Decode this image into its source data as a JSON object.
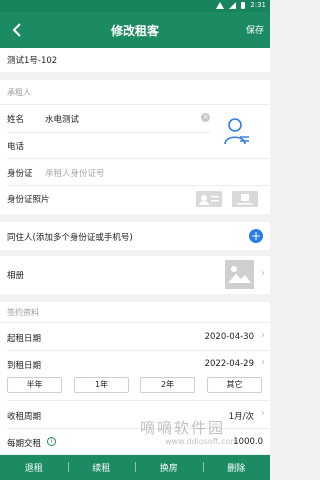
{
  "status_bar": {
    "time": "2:31"
  },
  "header": {
    "title": "修改租客",
    "save_label": "保存"
  },
  "property": {
    "name": "测试1号-102"
  },
  "tenant_section": {
    "heading": "承租人",
    "name_label": "姓名",
    "name_value": "水电测试",
    "phone_label": "电话",
    "id_label": "身份证",
    "id_placeholder": "承租人身份证号",
    "id_photo_label": "身份证照片"
  },
  "cohabitant": {
    "label": "同住人(添加多个身份证或手机号)"
  },
  "album": {
    "label": "相册"
  },
  "contract": {
    "heading": "签约资料",
    "start_label": "起租日期",
    "start_value": "2020-04-30",
    "end_label": "到租日期",
    "end_value": "2022-04-29",
    "durations": [
      "半年",
      "1年",
      "2年",
      "其它"
    ],
    "cycle_label": "收租周期",
    "cycle_value": "1月/次",
    "rent_label": "每期交租",
    "rent_value": "1000.0"
  },
  "bottom_bar": {
    "actions": [
      "退租",
      "续租",
      "换房",
      "删除"
    ]
  },
  "watermark": {
    "text": "嘀嘀软件园",
    "url": "www.ddiosoft.com"
  },
  "colors": {
    "brand_green": "#1c8b62",
    "accent_blue": "#2a7de1"
  }
}
